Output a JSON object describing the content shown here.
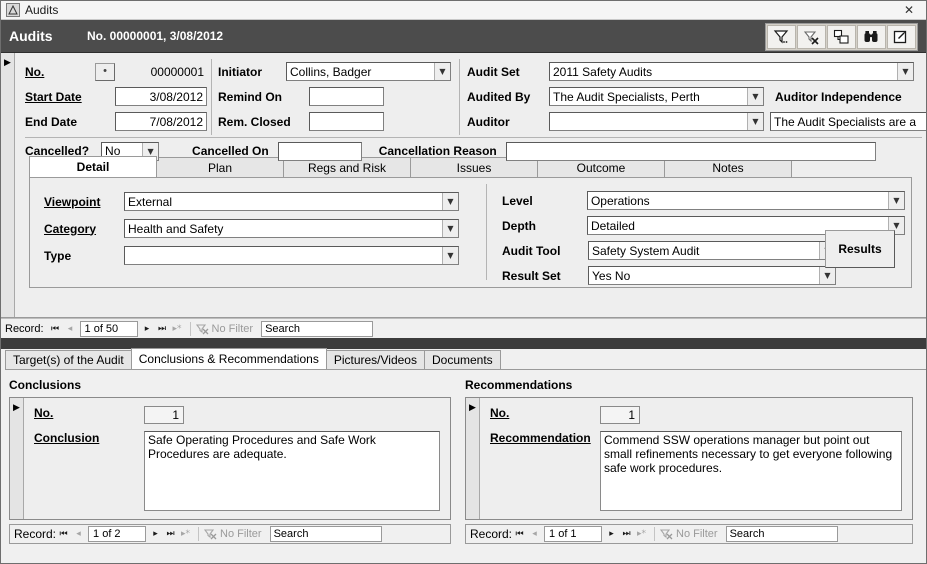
{
  "window": {
    "title": "Audits",
    "app_icon": "database-icon",
    "close_label": "✕"
  },
  "form_header": {
    "title": "Audits",
    "subtitle": "No. 00000001, 3/08/2012",
    "tools": [
      {
        "name": "filter-icon",
        "label": "Filter"
      },
      {
        "name": "clear-filter-icon",
        "label": "Clear Filter"
      },
      {
        "name": "duplicate-icon",
        "label": "Duplicate"
      },
      {
        "name": "find-icon",
        "label": "Find"
      },
      {
        "name": "edit-icon",
        "label": "Edit"
      }
    ]
  },
  "top_form": {
    "left": [
      {
        "label": "No.",
        "underline": true,
        "value": "00000001",
        "kind": "number-button"
      },
      {
        "label": "Start Date",
        "underline": true,
        "value": "3/08/2012",
        "kind": "text"
      },
      {
        "label": "End Date",
        "underline": false,
        "value": "7/08/2012",
        "kind": "text"
      }
    ],
    "mid": [
      {
        "label": "Initiator",
        "value": "Collins, Badger",
        "kind": "combo"
      },
      {
        "label": "Remind On",
        "value": "",
        "kind": "text"
      },
      {
        "label": "Rem. Closed",
        "value": "",
        "kind": "text"
      }
    ],
    "right": [
      {
        "label": "Audit Set",
        "value": "2011 Safety Audits",
        "kind": "combo"
      },
      {
        "label": "Audited By",
        "value": "The Audit Specialists, Perth",
        "kind": "combo"
      },
      {
        "label": "Auditor",
        "value": "",
        "kind": "combo"
      }
    ],
    "independence": {
      "label": "Auditor Independence",
      "value": "The Audit Specialists are a"
    },
    "cancelled": {
      "label": "Cancelled?",
      "value": "No",
      "on_label": "Cancelled On",
      "on_value": "",
      "reason_label": "Cancellation Reason",
      "reason_value": ""
    }
  },
  "tabs": [
    {
      "label": "Detail",
      "active": true
    },
    {
      "label": "Plan",
      "active": false
    },
    {
      "label": "Regs and Risk",
      "active": false
    },
    {
      "label": "Issues",
      "active": false
    },
    {
      "label": "Outcome",
      "active": false
    },
    {
      "label": "Notes",
      "active": false
    }
  ],
  "detail_tab": {
    "left": [
      {
        "label": "Viewpoint",
        "underline": true,
        "value": "External"
      },
      {
        "label": "Category",
        "underline": true,
        "value": "Health and Safety"
      },
      {
        "label": "Type",
        "underline": false,
        "value": ""
      }
    ],
    "right": [
      {
        "label": "Level",
        "value": "Operations"
      },
      {
        "label": "Depth",
        "value": "Detailed"
      },
      {
        "label": "Audit Tool",
        "value": "Safety System Audit"
      },
      {
        "label": "Result Set",
        "value": "Yes No"
      }
    ],
    "results_button": "Results"
  },
  "main_nav": {
    "record_label": "Record:",
    "position": "1 of 50",
    "filter_label": "No Filter",
    "search_label": "Search",
    "first": "⏮",
    "prev": "◂",
    "next": "▸",
    "last": "⏭",
    "new": "▸*"
  },
  "sub_tabs": [
    {
      "label": "Target(s) of the Audit",
      "active": false
    },
    {
      "label": "Conclusions & Recommendations",
      "active": true
    },
    {
      "label": "Pictures/Videos",
      "active": false
    },
    {
      "label": "Documents",
      "active": false
    }
  ],
  "conclusions": {
    "title": "Conclusions",
    "no_label": "No.",
    "no_value": "1",
    "memo_label": "Conclusion",
    "memo_value": "Safe Operating Procedures and Safe Work Procedures are adequate.",
    "nav": {
      "record_label": "Record:",
      "position": "1 of 2",
      "filter_label": "No Filter",
      "search_label": "Search"
    }
  },
  "recommendations": {
    "title": "Recommendations",
    "no_label": "No.",
    "no_value": "1",
    "memo_label": "Recommendation",
    "memo_value": "Commend SSW operations manager but point out small refinements necessary to get everyone following safe work procedures.",
    "nav": {
      "record_label": "Record:",
      "position": "1 of 1",
      "filter_label": "No Filter",
      "search_label": "Search"
    }
  },
  "colors": {
    "header_band": "#4c4c4c",
    "form_bg": "#eeeeee",
    "window_bg": "#f0f0f0",
    "dark_gap": "#3c3c3c"
  }
}
